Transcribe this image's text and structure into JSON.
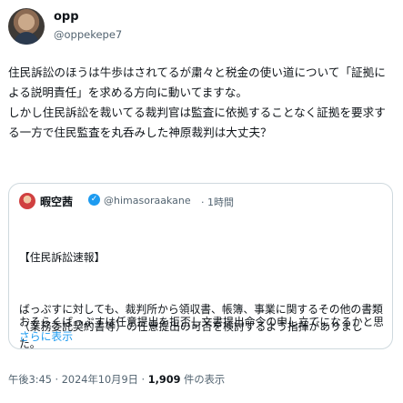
{
  "author": {
    "display_name": "opp",
    "handle": "@oppekepe7"
  },
  "body_text": "住民訴訟のほうは牛歩はされてるが粛々と税金の使い道について「証拠による説明責任」を求める方向に動いてますな。\nしかし住民訴訟を裁いてる裁判官は監査に依拠することなく証拠を要求する一方で住民監査を丸呑みした神原裁判は大丈夫？",
  "quote": {
    "display_name": "暇空茜",
    "verified_glyph": "✓",
    "handle": "@himasoraakane",
    "separator_time": "· 1時間",
    "lines": [
      "【住民訴訟速報】",
      "ばっぷすに対しても、裁判所から領収書、帳簿、事業に関するその他の書類（業務委託契約書等）の任意提出の可否を検討するよう指揮がありました。"
    ],
    "truncated_line": "おそらくばっぷすは任意提出を拒否し文書提出命令の申し立てになるかと思い...",
    "show_more": "さらに表示"
  },
  "meta": {
    "timestamp": "午後3:45 · 2024年10月9日 · ",
    "views_count": "1,909",
    "views_label": " 件の表示"
  },
  "colors": {
    "text": "#0f1419",
    "secondary": "#536471",
    "link": "#1d9bf0",
    "border": "#cfd9de",
    "verified": "#1d9bf0"
  },
  "icons": {
    "verified": "verified-badge-icon"
  }
}
